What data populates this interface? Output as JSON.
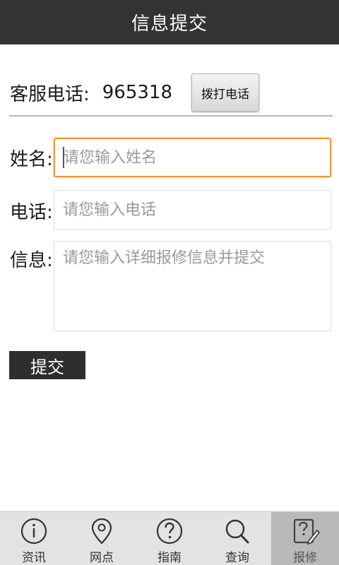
{
  "header": {
    "title": "信息提交"
  },
  "hotline": {
    "label": "客服电话:",
    "number": "965318",
    "call_button": "拨打电话"
  },
  "form": {
    "name": {
      "label": "姓名:",
      "placeholder": "请您输入姓名"
    },
    "phone": {
      "label": "电话:",
      "placeholder": "请您输入电话"
    },
    "info": {
      "label": "信息:",
      "placeholder": "请您输入详细报修信息并提交"
    },
    "submit_label": "提交"
  },
  "tabbar": {
    "items": [
      {
        "label": "资讯",
        "icon": "info-icon"
      },
      {
        "label": "网点",
        "icon": "location-pin-icon"
      },
      {
        "label": "指南",
        "icon": "help-icon"
      },
      {
        "label": "查询",
        "icon": "search-icon"
      },
      {
        "label": "报修",
        "icon": "repair-edit-icon",
        "active": true
      }
    ]
  },
  "colors": {
    "header_bg": "#333333",
    "focus_border": "#f0962a",
    "tabbar_bg": "#e3e3e3",
    "tab_active_bg": "#b9b9b9"
  }
}
